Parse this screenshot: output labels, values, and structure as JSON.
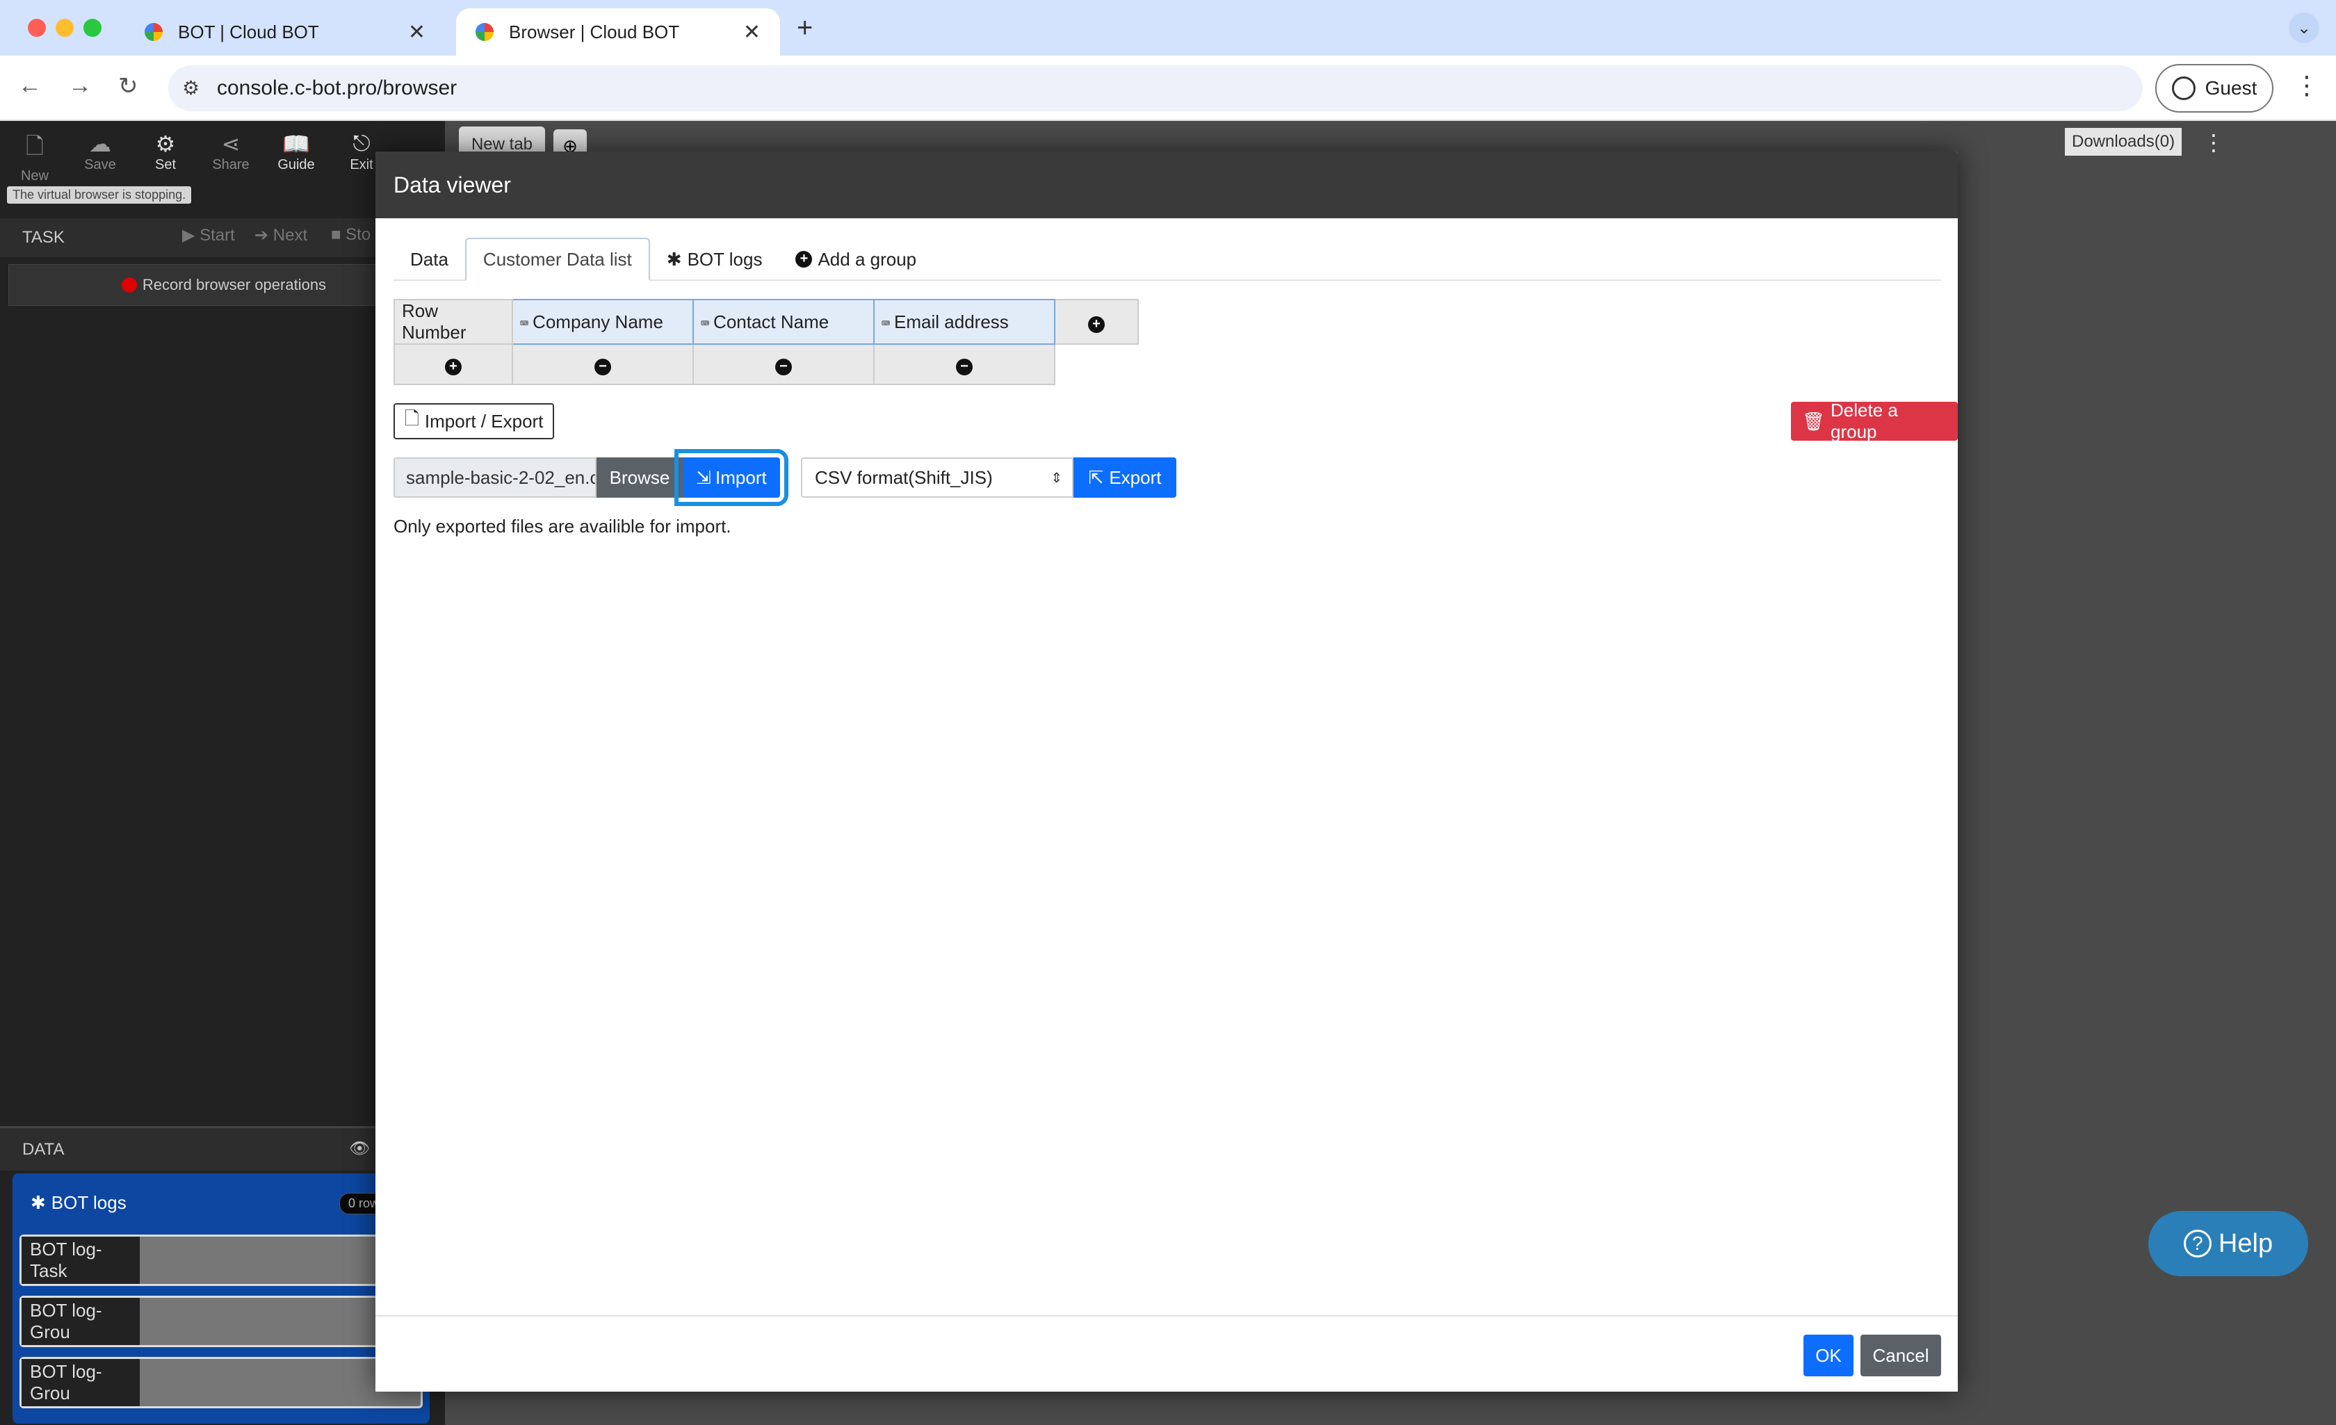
{
  "browser": {
    "tabs": [
      {
        "title": "BOT | Cloud BOT"
      },
      {
        "title": "Browser | Cloud BOT"
      }
    ],
    "url": "console.c-bot.pro/browser",
    "profile": "Guest"
  },
  "app": {
    "toolbar": [
      {
        "label": "New",
        "icon": "file-icon"
      },
      {
        "label": "Save",
        "icon": "cloud-icon"
      },
      {
        "label": "Set",
        "icon": "gear-icon"
      },
      {
        "label": "Share",
        "icon": "share-icon"
      },
      {
        "label": "Guide",
        "icon": "book-icon"
      },
      {
        "label": "Exit",
        "icon": "exit-icon"
      }
    ],
    "status": "The virtual browser is stopping.",
    "task_title": "TASK",
    "task_controls": {
      "start": "Start",
      "next": "Next",
      "stop": "Sto"
    },
    "record_label": "Record browser operations",
    "data_title": "DATA",
    "logs": {
      "title": "BOT logs",
      "badge": "0 row",
      "rows": [
        "BOT log-Task",
        "BOT log-Grou",
        "BOT log-Grou"
      ]
    },
    "inner_tab": "New tab",
    "downloads": "Downloads(0)",
    "help": "Help"
  },
  "modal": {
    "title": "Data viewer",
    "tabs": [
      "Data",
      "Customer Data list",
      "BOT logs",
      "Add a group"
    ],
    "columns": {
      "row_number": "Row Number",
      "fields": [
        "Company Name",
        "Contact Name",
        "Email address"
      ]
    },
    "import_export_label": "Import / Export",
    "delete_group_label": "Delete a group",
    "file_name": "sample-basic-2-02_en.c",
    "browse_label": "Browse",
    "import_label": "Import",
    "format_value": "CSV format(Shift_JIS)",
    "export_label": "Export",
    "note": "Only exported files are availible for import.",
    "ok_label": "OK",
    "cancel_label": "Cancel"
  }
}
